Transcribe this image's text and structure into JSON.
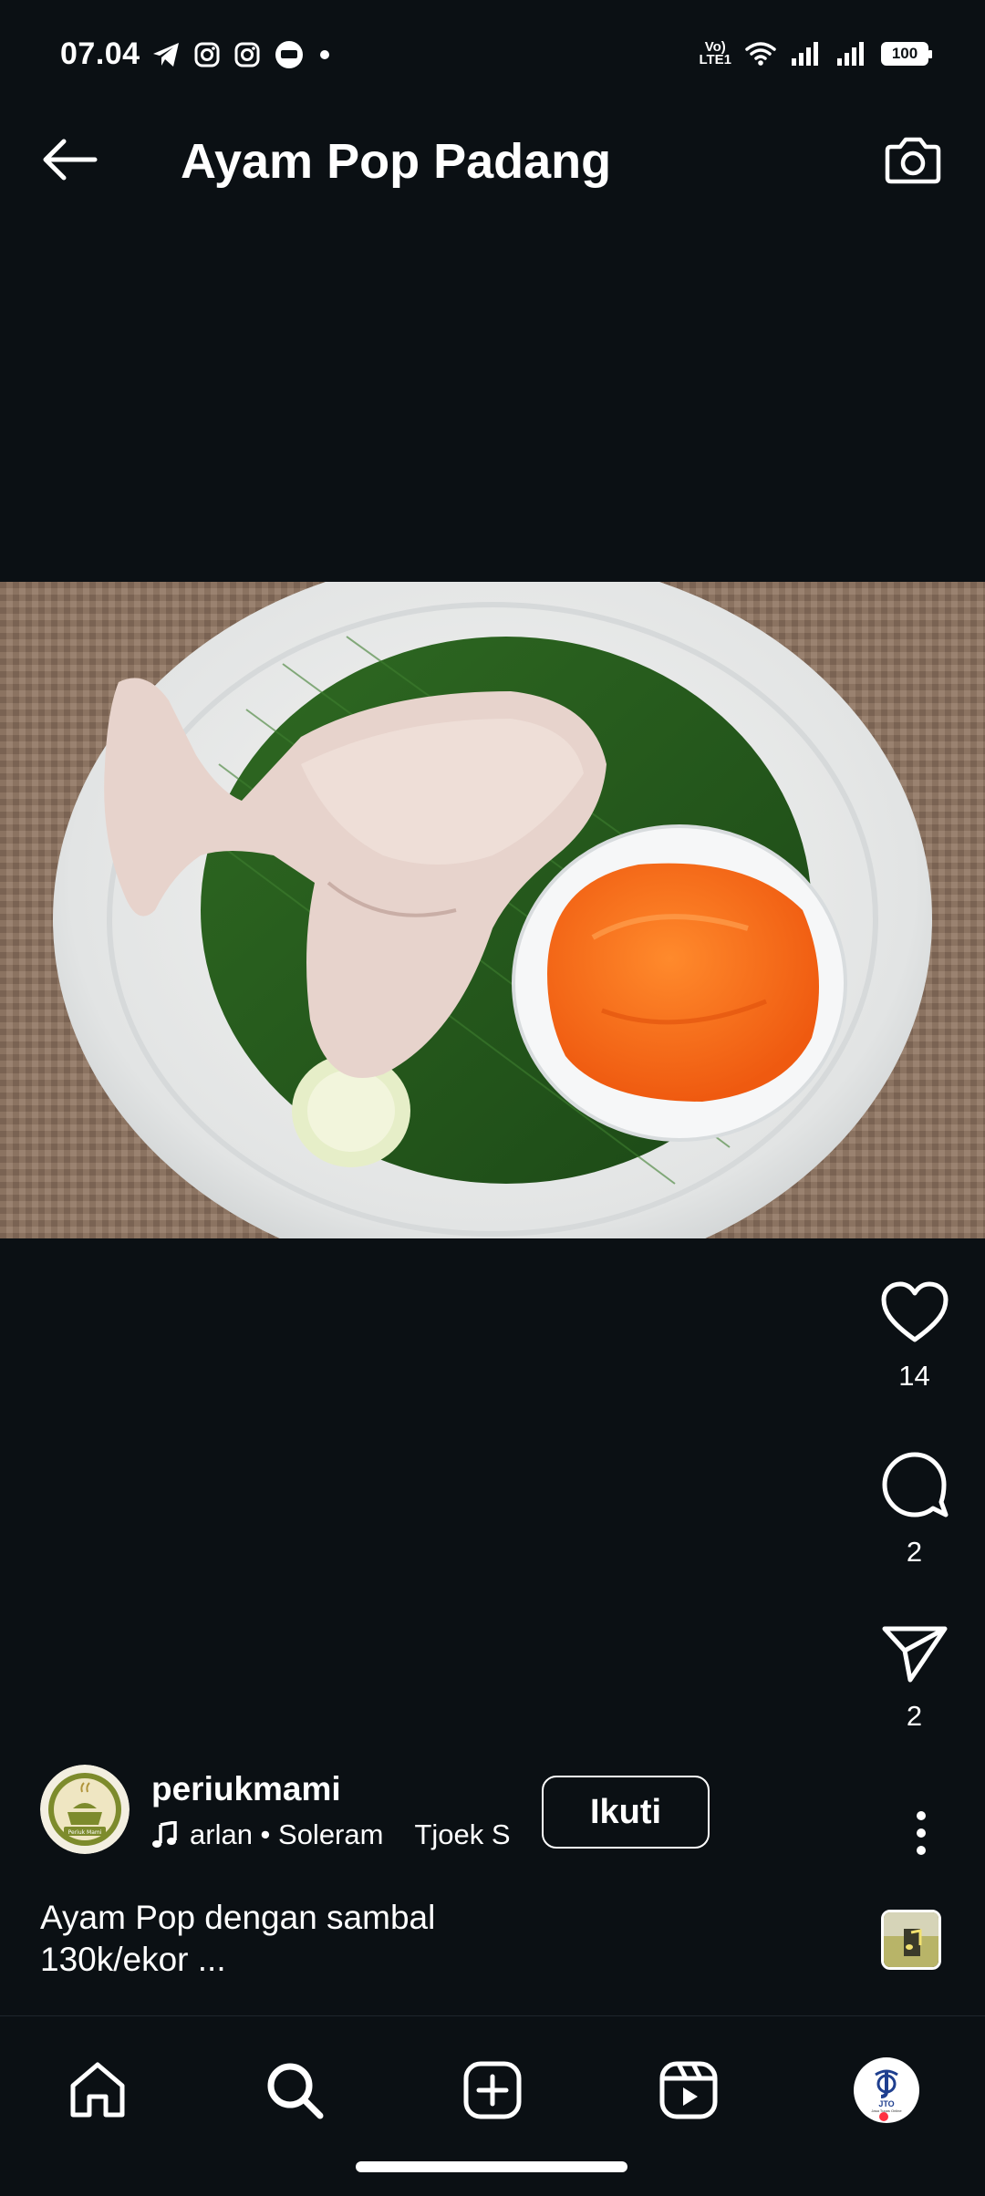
{
  "status_bar": {
    "time": "07.04",
    "battery": "100",
    "network_label_top": "Vo)",
    "network_label_bottom": "LTE1",
    "left_icons": [
      "telegram-icon",
      "instagram-icon",
      "instagram-icon",
      "chat-icon",
      "dot-icon"
    ],
    "right_icons": [
      "volte-icon",
      "wifi-icon",
      "signal-icon",
      "signal-icon",
      "battery-icon"
    ]
  },
  "header": {
    "title": "Ayam Pop Padang",
    "back_icon": "arrow-left-icon",
    "camera_icon": "camera-icon"
  },
  "post": {
    "likes": "14",
    "comments": "2",
    "shares": "2",
    "username": "periukmami",
    "avatar_text": "Periuk Mami",
    "music": {
      "artist": "arlan • Soleram",
      "next": "Tjoek S"
    },
    "follow_label": "Ikuti",
    "caption_line1": "Ayam Pop dengan sambal",
    "caption_line2": "130k/ekor ..."
  },
  "nav": {
    "items": [
      "home-icon",
      "search-icon",
      "create-icon",
      "reels-icon",
      "profile-avatar"
    ],
    "profile_text_top": "JTO",
    "profile_text_bottom": "Jasa Tugas Online"
  },
  "colors": {
    "background": "#0b1014",
    "text": "#ffffff",
    "notification_dot": "#ff3040"
  }
}
